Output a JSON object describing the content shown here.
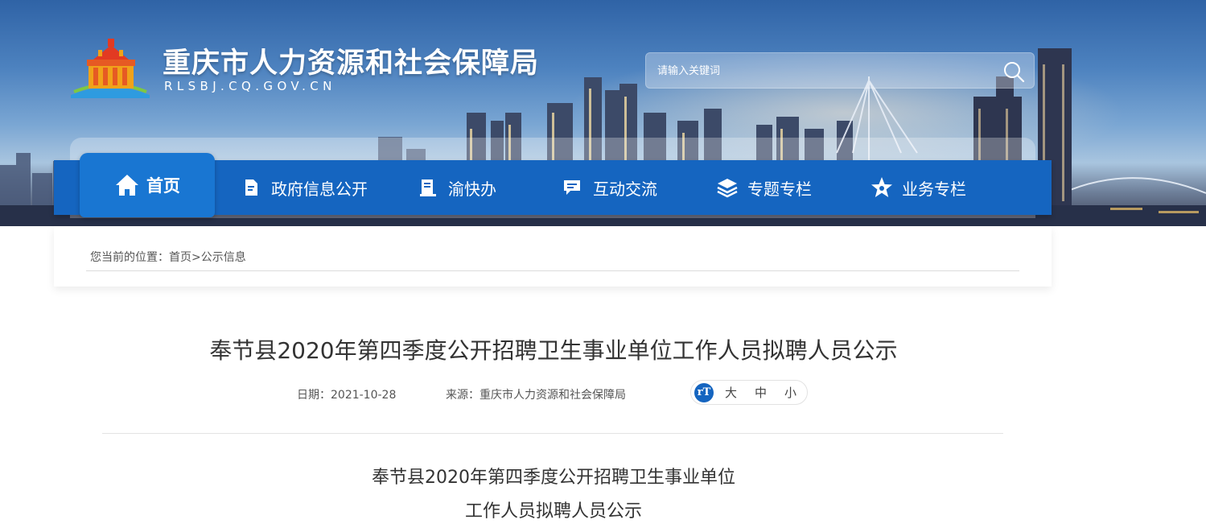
{
  "header": {
    "title": "重庆市人力资源和社会保障局",
    "domain": "RLSBJ.CQ.GOV.CN",
    "search_placeholder": "请输入关键词"
  },
  "nav": {
    "items": [
      {
        "label": "首页",
        "icon": "home-icon"
      },
      {
        "label": "政府信息公开",
        "icon": "document-icon"
      },
      {
        "label": "渝快办",
        "icon": "book-icon"
      },
      {
        "label": "互动交流",
        "icon": "chat-icon"
      },
      {
        "label": "专题专栏",
        "icon": "layers-icon"
      },
      {
        "label": "业务专栏",
        "icon": "star-icon"
      }
    ],
    "color": "#1565c0"
  },
  "breadcrumb": {
    "prefix": "您当前的位置：",
    "home": "首页",
    "separator": ">",
    "current": "公示信息"
  },
  "article": {
    "title": "奉节县2020年第四季度公开招聘卫生事业单位工作人员拟聘人员公示",
    "date_label": "日期：",
    "date": "2021-10-28",
    "source_label": "来源：",
    "source": "重庆市人力资源和社会保障局",
    "font_size_options": [
      "大",
      "中",
      "小"
    ],
    "font_size_icon": "rT",
    "body_title_line1": "奉节县2020年第四季度公开招聘卫生事业单位",
    "body_title_line2": "工作人员拟聘人员公示"
  }
}
